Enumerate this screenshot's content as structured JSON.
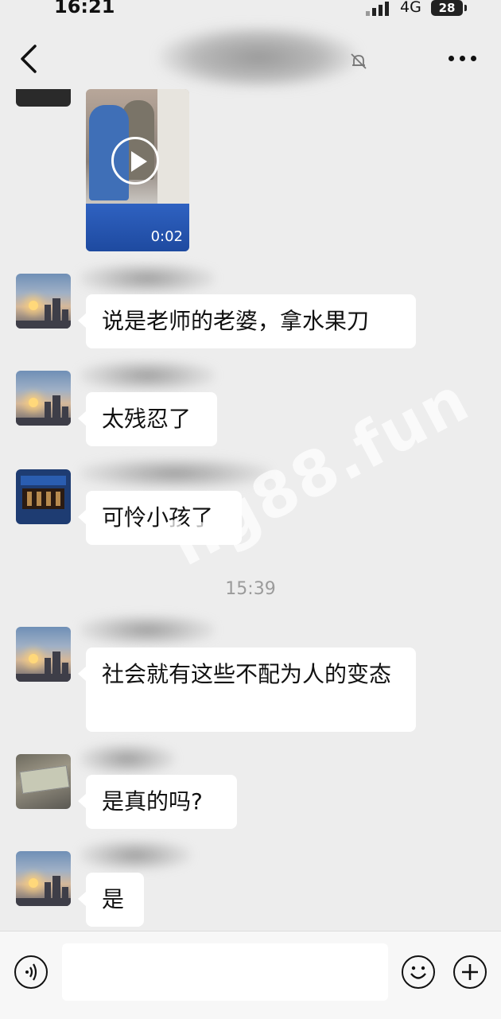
{
  "status_bar": {
    "time": "16:21",
    "network": "4G",
    "battery": "28"
  },
  "header": {
    "title": ""
  },
  "video": {
    "duration": "0:02"
  },
  "messages": [
    {
      "text": "说是老师的老婆，拿水果刀"
    },
    {
      "text": "太残忍了"
    },
    {
      "text": "可怜小孩了"
    },
    {
      "text": "社会就有这些不配为人的变态"
    },
    {
      "text": "是真的吗?"
    },
    {
      "text": "是"
    }
  ],
  "timestamp": "15:39",
  "watermark": "hg88.fun",
  "input": {
    "value": "",
    "placeholder": ""
  },
  "icons": [
    "back-icon",
    "mute-bell-icon",
    "more-icon",
    "play-icon",
    "voice-icon",
    "emoji-icon",
    "plus-icon"
  ]
}
